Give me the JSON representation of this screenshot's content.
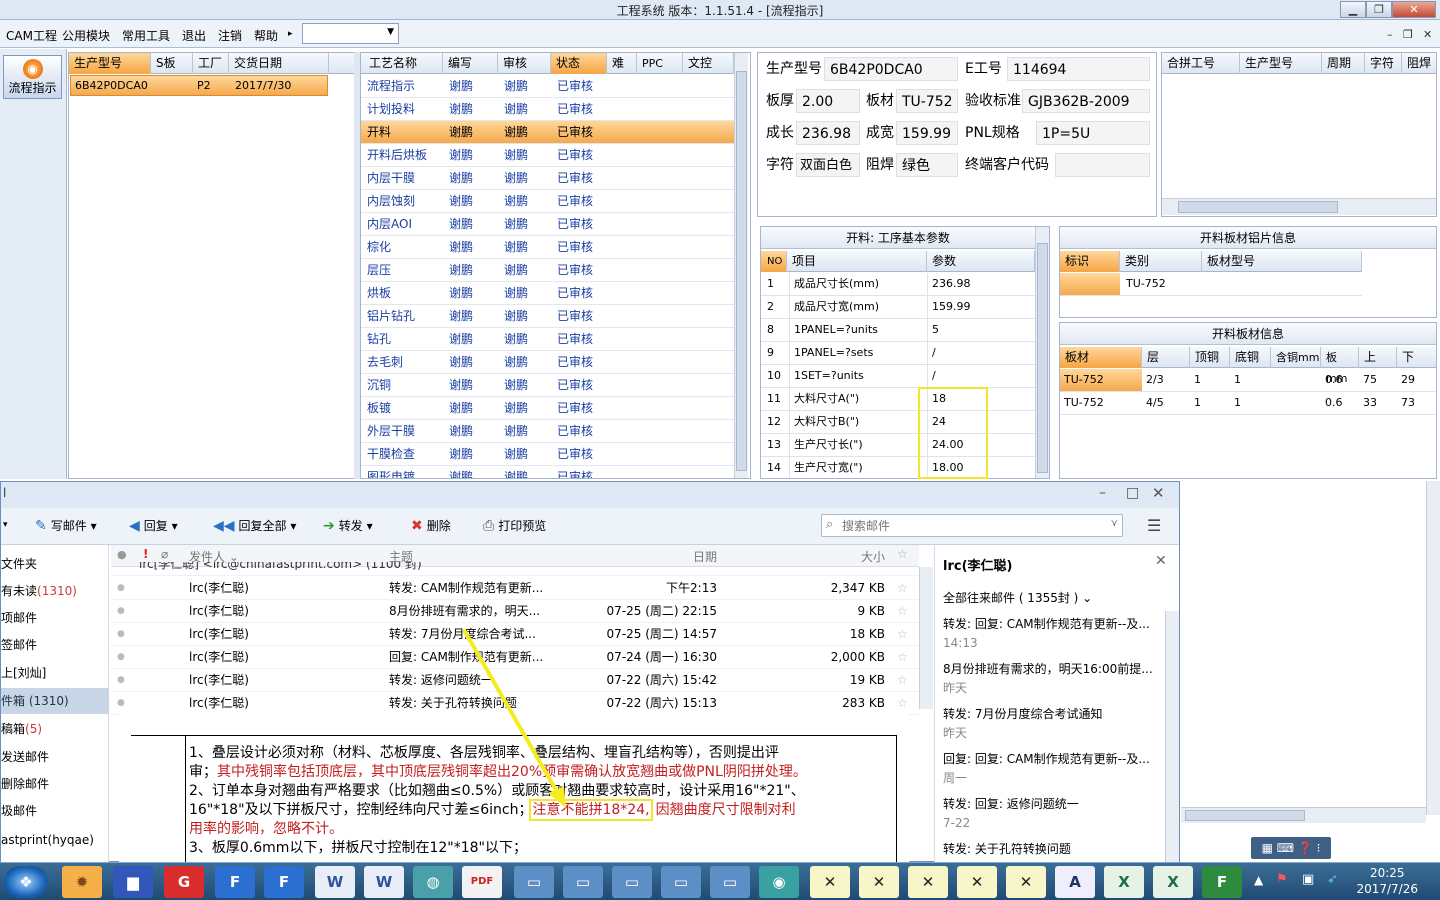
{
  "app": {
    "title": "工程系统   版本：1.1.51.4 - [流程指示]",
    "window_controls": {
      "min": "▁",
      "max": "❐",
      "close": "✕"
    },
    "menu": [
      "CAM工程",
      "公用模块",
      "常用工具",
      "退出",
      "注销",
      "帮助"
    ],
    "menu_arrow": "▸",
    "combo_value": "",
    "mdi_controls": {
      "min": "–",
      "restore": "❐",
      "close": "✕"
    },
    "flow_button": "流程指示"
  },
  "orders": {
    "headers": [
      "生产型号",
      "S板",
      "工厂",
      "交货日期"
    ],
    "rows": [
      {
        "model": "6B42P0DCA0",
        "s": "",
        "factory": "P2",
        "date": "2017/7/30"
      }
    ]
  },
  "process": {
    "headers": [
      "工艺名称",
      "编写",
      "审核",
      "状态",
      "难",
      "PPC",
      "文控"
    ],
    "rows": [
      {
        "name": "流程指示",
        "writer": "谢鹏",
        "reviewer": "谢鹏",
        "status": "已审核"
      },
      {
        "name": "计划投料",
        "writer": "谢鹏",
        "reviewer": "谢鹏",
        "status": "已审核"
      },
      {
        "name": "开料",
        "writer": "谢鹏",
        "reviewer": "谢鹏",
        "status": "已审核"
      },
      {
        "name": "开料后烘板",
        "writer": "谢鹏",
        "reviewer": "谢鹏",
        "status": "已审核"
      },
      {
        "name": "内层干膜",
        "writer": "谢鹏",
        "reviewer": "谢鹏",
        "status": "已审核"
      },
      {
        "name": "内层蚀刻",
        "writer": "谢鹏",
        "reviewer": "谢鹏",
        "status": "已审核"
      },
      {
        "name": "内层AOI",
        "writer": "谢鹏",
        "reviewer": "谢鹏",
        "status": "已审核"
      },
      {
        "name": "棕化",
        "writer": "谢鹏",
        "reviewer": "谢鹏",
        "status": "已审核"
      },
      {
        "name": "层压",
        "writer": "谢鹏",
        "reviewer": "谢鹏",
        "status": "已审核"
      },
      {
        "name": "烘板",
        "writer": "谢鹏",
        "reviewer": "谢鹏",
        "status": "已审核"
      },
      {
        "name": "铝片钻孔",
        "writer": "谢鹏",
        "reviewer": "谢鹏",
        "status": "已审核"
      },
      {
        "name": "钻孔",
        "writer": "谢鹏",
        "reviewer": "谢鹏",
        "status": "已审核"
      },
      {
        "name": "去毛刺",
        "writer": "谢鹏",
        "reviewer": "谢鹏",
        "status": "已审核"
      },
      {
        "name": "沉铜",
        "writer": "谢鹏",
        "reviewer": "谢鹏",
        "status": "已审核"
      },
      {
        "name": "板镀",
        "writer": "谢鹏",
        "reviewer": "谢鹏",
        "status": "已审核"
      },
      {
        "name": "外层干膜",
        "writer": "谢鹏",
        "reviewer": "谢鹏",
        "status": "已审核"
      },
      {
        "name": "干膜检查",
        "writer": "谢鹏",
        "reviewer": "谢鹏",
        "status": "已审核"
      },
      {
        "name": "图形电镀",
        "writer": "谢鹏",
        "reviewer": "谢鹏",
        "status": "已审核"
      }
    ]
  },
  "info": {
    "model_label": "生产型号",
    "model": "6B42P0DCA0",
    "e_label": "E工号",
    "e": "114694",
    "thick_label": "板厚",
    "thick": "2.00",
    "material_label": "板材",
    "material": "TU-752",
    "standard_label": "验收标准",
    "standard": "GJB362B-2009",
    "len_label": "成长",
    "len": "236.98",
    "wid_label": "成宽",
    "wid": "159.99",
    "pnl_label": "PNL规格",
    "pnl": "1P=5U",
    "char_label": "字符",
    "char": "双面白色",
    "mask_label": "阻焊",
    "mask": "绿色",
    "client_label": "终端客户代码",
    "client": ""
  },
  "merge": {
    "headers": [
      "合拼工号",
      "生产型号",
      "周期",
      "字符",
      "阻焊"
    ]
  },
  "params": {
    "title": "开料: 工序基本参数",
    "headers": [
      "NO",
      "项目",
      "参数"
    ],
    "rows": [
      {
        "no": "1",
        "item": "成品尺寸长(mm)",
        "value": "236.98"
      },
      {
        "no": "2",
        "item": "成品尺寸宽(mm)",
        "value": "159.99"
      },
      {
        "no": "8",
        "item": "1PANEL=?units",
        "value": "5"
      },
      {
        "no": "9",
        "item": "1PANEL=?sets",
        "value": "/"
      },
      {
        "no": "10",
        "item": "1SET=?units",
        "value": "/"
      },
      {
        "no": "11",
        "item": "大料尺寸A(\")",
        "value": "18"
      },
      {
        "no": "12",
        "item": "大料尺寸B(\")",
        "value": "24"
      },
      {
        "no": "13",
        "item": "生产尺寸长(\")",
        "value": "24.00"
      },
      {
        "no": "14",
        "item": "生产尺寸宽(\")",
        "value": "18.00"
      }
    ]
  },
  "alu": {
    "title": "开料板材铝片信息",
    "headers": [
      "标识",
      "类别",
      "板材型号"
    ],
    "rows": [
      {
        "mark": "",
        "type": "TU-752",
        "model": ""
      }
    ]
  },
  "boards": {
    "title": "开料板材信息",
    "headers": [
      "板材",
      "层",
      "顶铜",
      "底铜",
      "含铜mm",
      "板mm",
      "上",
      "下"
    ],
    "rows": [
      {
        "board": "TU-752",
        "layer": "2/3",
        "top": "1",
        "bottom": "1",
        "cu": "",
        "thick": "0.6",
        "up": "75",
        "down": "29"
      },
      {
        "board": "TU-752",
        "layer": "4/5",
        "top": "1",
        "bottom": "1",
        "cu": "",
        "thick": "0.6",
        "up": "33",
        "down": "73"
      }
    ]
  },
  "mail": {
    "toolbar": {
      "write": "写邮件",
      "reply": "回复",
      "reply_all": "回复全部",
      "forward": "转发",
      "delete": "删除",
      "print": "打印预览",
      "search_placeholder": "搜索邮件"
    },
    "window_controls": {
      "min": "–",
      "max": "□",
      "close": "✕"
    },
    "folders": [
      {
        "label": "文件夹",
        "count": ""
      },
      {
        "label": "有未读",
        "count": "(1310)"
      },
      {
        "label": "项邮件",
        "count": ""
      },
      {
        "label": "签邮件",
        "count": ""
      },
      {
        "label": "上[刘灿]",
        "count": ""
      },
      {
        "label": "件箱 (1310)",
        "count": ""
      },
      {
        "label": "稿箱",
        "count": "(5)"
      },
      {
        "label": "发送邮件",
        "count": ""
      },
      {
        "label": "删除邮件",
        "count": ""
      },
      {
        "label": "圾邮件",
        "count": ""
      },
      {
        "label": "astprint(hyqae)",
        "count": ""
      }
    ],
    "headers": {
      "sender": "发件人",
      "subject": "主题",
      "date": "日期",
      "size": "大小"
    },
    "partial_row": "lrc[李仁聪] <lrc@chinafastprint.com> (1100 封)",
    "messages": [
      {
        "from": "lrc(李仁聪)",
        "subject": "转发: CAM制作规范有更新...",
        "date": "下午2:13",
        "size": "2,347 KB"
      },
      {
        "from": "lrc(李仁聪)",
        "subject": "8月份排班有需求的，明天...",
        "date": "07-25 (周二) 22:15",
        "size": "9 KB"
      },
      {
        "from": "lrc(李仁聪)",
        "subject": "转发: 7月份月度综合考试...",
        "date": "07-25 (周二) 14:57",
        "size": "18 KB"
      },
      {
        "from": "lrc(李仁聪)",
        "subject": "回复: CAM制作规范有更新...",
        "date": "07-24 (周一) 16:30",
        "size": "2,000 KB"
      },
      {
        "from": "lrc(李仁聪)",
        "subject": "转发: 返修问题统一",
        "date": "07-22 (周六) 15:42",
        "size": "19 KB"
      },
      {
        "from": "lrc(李仁聪)",
        "subject": "转发: 关于孔符转换问题",
        "date": "07-22 (周六) 15:13",
        "size": "283 KB"
      }
    ],
    "body": {
      "l1": "1、叠层设计必须对称（材料、芯板厚度、各层残铜率、叠层结构、埋盲孔结构等），否则提出评",
      "l2a": "审；",
      "l2b": "其中残铜率包括顶底层，其中顶底层残铜率超出20%预审需确认放宽翘曲或做PNL阴阳拼处理。",
      "l3": "2、订单本身对翘曲有严格要求（比如翘曲≤0.5%）或顾客对翘曲要求较高时，设计采用16\"*21\"、",
      "l4a": "16\"*18\"及以下拼板尺寸，控制经纬向尺寸差≤6inch；",
      "l4b": "注意不能拼18*24,",
      "l4c": "因翘曲度尺寸限制对利",
      "l5": "用率的影响，忽略不计。",
      "l6": "3、板厚0.6mm以下，拼板尺寸控制在12\"*18\"以下；"
    },
    "contact": {
      "name": "lrc(李仁聪)",
      "filter": "全部往来邮件 ( 1355封 )",
      "items": [
        {
          "subject": "转发: 回复: CAM制作规范有更新--及...",
          "time": "14:13"
        },
        {
          "subject": "8月份排班有需求的，明天16:00前提...",
          "time": "昨天"
        },
        {
          "subject": "转发: 7月份月度综合考试通知",
          "time": "昨天"
        },
        {
          "subject": "回复: 回复: CAM制作规范有更新--及...",
          "time": "周一"
        },
        {
          "subject": "转发: 回复: 返修问题统一",
          "time": "7-22"
        },
        {
          "subject": "转发: 关于孔符转换问题",
          "time": ""
        }
      ]
    }
  },
  "taskbar": {
    "time": "20:25",
    "date": "2017/7/26"
  },
  "colors": {
    "selection": "#f8b960",
    "highlight": "#f1e62b",
    "link": "#1b3fa3",
    "alert_text": "#c41f1f"
  }
}
